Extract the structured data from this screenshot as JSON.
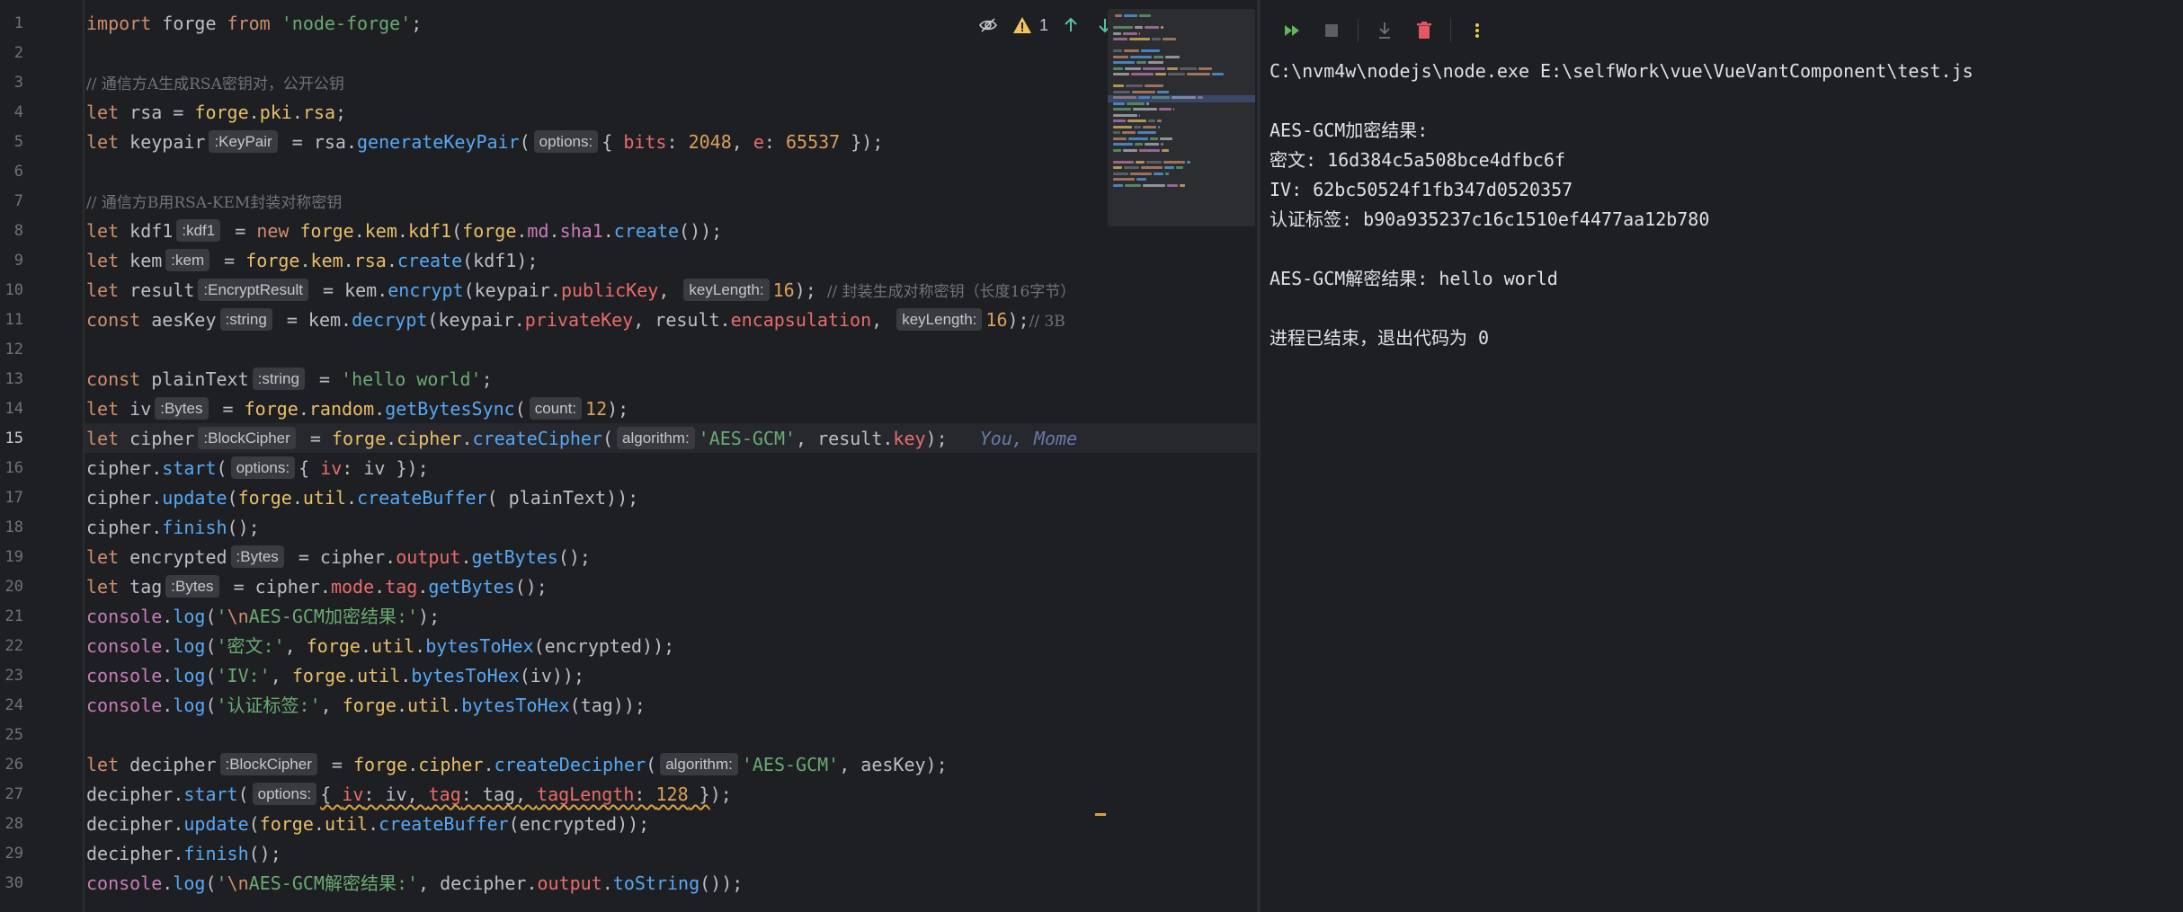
{
  "editor": {
    "active_line": 15,
    "line_numbers": [
      "1",
      "2",
      "3",
      "4",
      "5",
      "6",
      "7",
      "8",
      "9",
      "10",
      "11",
      "12",
      "13",
      "14",
      "15",
      "16",
      "17",
      "18",
      "19",
      "20",
      "21",
      "22",
      "23",
      "24",
      "25",
      "26",
      "27",
      "28",
      "29",
      "30"
    ],
    "warning_count": "1",
    "icons": [
      "reader-mode-icon",
      "warning-icon",
      "arrow-up-icon",
      "arrow-down-icon"
    ],
    "lines": [
      [
        [
          "kw",
          "import"
        ],
        [
          "id",
          " forge "
        ],
        [
          "kw",
          "from"
        ],
        [
          "id",
          " "
        ],
        [
          "str",
          "'node-forge'"
        ],
        [
          "id",
          ";"
        ]
      ],
      [],
      [
        [
          "cmt",
          "// 通信方A生成RSA密钥对，公开公钥"
        ]
      ],
      [
        [
          "kw",
          "let"
        ],
        [
          "id",
          " rsa = "
        ],
        [
          "obj",
          "forge"
        ],
        [
          "id",
          "."
        ],
        [
          "obj",
          "pki"
        ],
        [
          "id",
          "."
        ],
        [
          "obj",
          "rsa"
        ],
        [
          "id",
          ";"
        ]
      ],
      [
        [
          "kw",
          "let"
        ],
        [
          "id",
          " keypair"
        ],
        [
          "hint",
          ":KeyPair"
        ],
        [
          "id",
          " = rsa."
        ],
        [
          "fn",
          "generateKeyPair"
        ],
        [
          "id",
          "("
        ],
        [
          "hint",
          "options:"
        ],
        [
          "id",
          "{ "
        ],
        [
          "red",
          "bits"
        ],
        [
          "id",
          ": "
        ],
        [
          "numo",
          "2048"
        ],
        [
          "id",
          ", "
        ],
        [
          "red",
          "e"
        ],
        [
          "id",
          ": "
        ],
        [
          "numo",
          "65537"
        ],
        [
          "id",
          " });"
        ]
      ],
      [],
      [
        [
          "cmt",
          "// 通信方B用RSA-KEM封装对称密钥"
        ]
      ],
      [
        [
          "kw",
          "let"
        ],
        [
          "id",
          " kdf1"
        ],
        [
          "hint",
          ":kdf1"
        ],
        [
          "id",
          " = "
        ],
        [
          "kw",
          "new"
        ],
        [
          "id",
          " "
        ],
        [
          "obj",
          "forge"
        ],
        [
          "id",
          "."
        ],
        [
          "obj",
          "kem"
        ],
        [
          "id",
          "."
        ],
        [
          "obj",
          "kdf1"
        ],
        [
          "id",
          "("
        ],
        [
          "obj",
          "forge"
        ],
        [
          "id",
          "."
        ],
        [
          "prop",
          "md"
        ],
        [
          "id",
          "."
        ],
        [
          "prop",
          "sha1"
        ],
        [
          "id",
          "."
        ],
        [
          "fn",
          "create"
        ],
        [
          "id",
          "());"
        ]
      ],
      [
        [
          "kw",
          "let"
        ],
        [
          "id",
          " kem"
        ],
        [
          "hint",
          ":kem"
        ],
        [
          "id",
          " = "
        ],
        [
          "obj",
          "forge"
        ],
        [
          "id",
          "."
        ],
        [
          "obj",
          "kem"
        ],
        [
          "id",
          "."
        ],
        [
          "obj",
          "rsa"
        ],
        [
          "id",
          "."
        ],
        [
          "fn",
          "create"
        ],
        [
          "id",
          "(kdf1);"
        ]
      ],
      [
        [
          "kw",
          "let"
        ],
        [
          "id",
          " result"
        ],
        [
          "hint",
          ":EncryptResult"
        ],
        [
          "id",
          " = kem."
        ],
        [
          "fn",
          "encrypt"
        ],
        [
          "id",
          "(keypair."
        ],
        [
          "red",
          "publicKey"
        ],
        [
          "id",
          ", "
        ],
        [
          "hint",
          "keyLength:"
        ],
        [
          "numo",
          "16"
        ],
        [
          "id",
          "); "
        ],
        [
          "cmt",
          "// 封装生成对称密钥（长度16字节）"
        ]
      ],
      [
        [
          "kw",
          "const"
        ],
        [
          "id",
          " aesKey"
        ],
        [
          "hint",
          ":string"
        ],
        [
          "id",
          " = kem."
        ],
        [
          "fn",
          "decrypt"
        ],
        [
          "id",
          "(keypair."
        ],
        [
          "red",
          "privateKey"
        ],
        [
          "id",
          ", result."
        ],
        [
          "red",
          "encapsulation"
        ],
        [
          "id",
          ", "
        ],
        [
          "hint",
          "keyLength:"
        ],
        [
          "numo",
          "16"
        ],
        [
          "id",
          ");"
        ],
        [
          "cmt",
          "// 3B"
        ]
      ],
      [],
      [
        [
          "kw",
          "const"
        ],
        [
          "id",
          " plainText"
        ],
        [
          "hint",
          ":string"
        ],
        [
          "id",
          " = "
        ],
        [
          "str",
          "'hello world'"
        ],
        [
          "id",
          ";"
        ]
      ],
      [
        [
          "kw",
          "let"
        ],
        [
          "id",
          " iv"
        ],
        [
          "hint",
          ":Bytes"
        ],
        [
          "id",
          " = "
        ],
        [
          "obj",
          "forge"
        ],
        [
          "id",
          "."
        ],
        [
          "obj",
          "random"
        ],
        [
          "id",
          "."
        ],
        [
          "fn",
          "getBytesSync"
        ],
        [
          "id",
          "("
        ],
        [
          "hint",
          "count:"
        ],
        [
          "numo",
          "12"
        ],
        [
          "id",
          ");"
        ]
      ],
      [
        [
          "kw",
          "let"
        ],
        [
          "id",
          " cipher"
        ],
        [
          "hint",
          ":BlockCipher"
        ],
        [
          "id",
          " = "
        ],
        [
          "obj",
          "forge"
        ],
        [
          "id",
          "."
        ],
        [
          "obj",
          "cipher"
        ],
        [
          "id",
          "."
        ],
        [
          "fn",
          "createCipher"
        ],
        [
          "id",
          "("
        ],
        [
          "hint",
          "algorithm:"
        ],
        [
          "str",
          "'AES-GCM'"
        ],
        [
          "id",
          ", result."
        ],
        [
          "red",
          "key"
        ],
        [
          "id",
          ");   "
        ],
        [
          "blame",
          "You, Mome"
        ]
      ],
      [
        [
          "id",
          "cipher."
        ],
        [
          "fn",
          "start"
        ],
        [
          "id",
          "("
        ],
        [
          "hint",
          "options:"
        ],
        [
          "id",
          "{ "
        ],
        [
          "red",
          "iv"
        ],
        [
          "id",
          ": iv });"
        ]
      ],
      [
        [
          "id",
          "cipher."
        ],
        [
          "fn",
          "update"
        ],
        [
          "id",
          "("
        ],
        [
          "obj",
          "forge"
        ],
        [
          "id",
          "."
        ],
        [
          "obj",
          "util"
        ],
        [
          "id",
          "."
        ],
        [
          "fn",
          "createBuffer"
        ],
        [
          "id",
          "( plainText));"
        ]
      ],
      [
        [
          "id",
          "cipher."
        ],
        [
          "fn",
          "finish"
        ],
        [
          "id",
          "();"
        ]
      ],
      [
        [
          "kw",
          "let"
        ],
        [
          "id",
          " encrypted"
        ],
        [
          "hint",
          ":Bytes"
        ],
        [
          "id",
          " = cipher."
        ],
        [
          "red",
          "output"
        ],
        [
          "id",
          "."
        ],
        [
          "fn",
          "getBytes"
        ],
        [
          "id",
          "();"
        ]
      ],
      [
        [
          "kw",
          "let"
        ],
        [
          "id",
          " tag"
        ],
        [
          "hint",
          ":Bytes"
        ],
        [
          "id",
          " = cipher."
        ],
        [
          "red",
          "mode"
        ],
        [
          "id",
          "."
        ],
        [
          "red",
          "tag"
        ],
        [
          "id",
          "."
        ],
        [
          "fn",
          "getBytes"
        ],
        [
          "id",
          "();"
        ]
      ],
      [
        [
          "pink",
          "console"
        ],
        [
          "id",
          "."
        ],
        [
          "fn",
          "log"
        ],
        [
          "id",
          "("
        ],
        [
          "str",
          "'"
        ],
        [
          "esc",
          "\\n"
        ],
        [
          "str",
          "AES-GCM加密结果:'"
        ],
        [
          "id",
          ");"
        ]
      ],
      [
        [
          "pink",
          "console"
        ],
        [
          "id",
          "."
        ],
        [
          "fn",
          "log"
        ],
        [
          "id",
          "("
        ],
        [
          "str",
          "'密文:'"
        ],
        [
          "id",
          ", "
        ],
        [
          "obj",
          "forge"
        ],
        [
          "id",
          "."
        ],
        [
          "obj",
          "util"
        ],
        [
          "id",
          "."
        ],
        [
          "fn",
          "bytesToHex"
        ],
        [
          "id",
          "(encrypted));"
        ]
      ],
      [
        [
          "pink",
          "console"
        ],
        [
          "id",
          "."
        ],
        [
          "fn",
          "log"
        ],
        [
          "id",
          "("
        ],
        [
          "str",
          "'IV:'"
        ],
        [
          "id",
          ", "
        ],
        [
          "obj",
          "forge"
        ],
        [
          "id",
          "."
        ],
        [
          "obj",
          "util"
        ],
        [
          "id",
          "."
        ],
        [
          "fn",
          "bytesToHex"
        ],
        [
          "id",
          "(iv));"
        ]
      ],
      [
        [
          "pink",
          "console"
        ],
        [
          "id",
          "."
        ],
        [
          "fn",
          "log"
        ],
        [
          "id",
          "("
        ],
        [
          "str",
          "'认证标签:'"
        ],
        [
          "id",
          ", "
        ],
        [
          "obj",
          "forge"
        ],
        [
          "id",
          "."
        ],
        [
          "obj",
          "util"
        ],
        [
          "id",
          "."
        ],
        [
          "fn",
          "bytesToHex"
        ],
        [
          "id",
          "(tag));"
        ]
      ],
      [],
      [
        [
          "kw",
          "let"
        ],
        [
          "id",
          " decipher"
        ],
        [
          "hint",
          ":BlockCipher"
        ],
        [
          "id",
          " = "
        ],
        [
          "obj",
          "forge"
        ],
        [
          "id",
          "."
        ],
        [
          "obj",
          "cipher"
        ],
        [
          "id",
          "."
        ],
        [
          "fn",
          "createDecipher"
        ],
        [
          "id",
          "("
        ],
        [
          "hint",
          "algorithm:"
        ],
        [
          "str",
          "'AES-GCM'"
        ],
        [
          "id",
          ", aesKey);"
        ]
      ],
      [
        [
          "id",
          "decipher."
        ],
        [
          "fn",
          "start"
        ],
        [
          "id",
          "("
        ],
        [
          "hint",
          "options:"
        ],
        [
          "warn",
          "{ "
        ],
        [
          "warnred",
          "iv"
        ],
        [
          "warn",
          ": iv, "
        ],
        [
          "warnred",
          "tag"
        ],
        [
          "warn",
          ": tag, "
        ],
        [
          "warnred",
          "tagLength"
        ],
        [
          "warn",
          ": "
        ],
        [
          "warnnum",
          "128"
        ],
        [
          "warn",
          " }"
        ],
        [
          "id",
          ");"
        ]
      ],
      [
        [
          "id",
          "decipher."
        ],
        [
          "fn",
          "update"
        ],
        [
          "id",
          "("
        ],
        [
          "obj",
          "forge"
        ],
        [
          "id",
          "."
        ],
        [
          "obj",
          "util"
        ],
        [
          "id",
          "."
        ],
        [
          "fn",
          "createBuffer"
        ],
        [
          "id",
          "(encrypted));"
        ]
      ],
      [
        [
          "id",
          "decipher."
        ],
        [
          "fn",
          "finish"
        ],
        [
          "id",
          "();"
        ]
      ],
      [
        [
          "pink",
          "console"
        ],
        [
          "id",
          "."
        ],
        [
          "fn",
          "log"
        ],
        [
          "id",
          "("
        ],
        [
          "str",
          "'"
        ],
        [
          "esc",
          "\\n"
        ],
        [
          "str",
          "AES-GCM解密结果:'"
        ],
        [
          "id",
          ", decipher."
        ],
        [
          "red",
          "output"
        ],
        [
          "id",
          "."
        ],
        [
          "fn",
          "toString"
        ],
        [
          "id",
          "());"
        ]
      ]
    ]
  },
  "console": {
    "toolbar": [
      "rerun-icon",
      "stop-icon",
      "scroll-to-end-icon",
      "clear-icon",
      "more-icon"
    ],
    "lines": [
      "C:\\nvm4w\\nodejs\\node.exe E:\\selfWork\\vue\\VueVantComponent\\test.js",
      "",
      "AES-GCM加密结果:",
      "密文: 16d384c5a508bce4dfbc6f",
      "IV: 62bc50524f1fb347d0520357",
      "认证标签: b90a935237c16c1510ef4477aa12b780",
      "",
      "AES-GCM解密结果: hello world",
      "",
      "进程已结束，退出代码为 0"
    ]
  },
  "colors": {
    "background": "#1e1f22",
    "keyword": "#cf8e6d",
    "function": "#56a8f5",
    "string": "#6aab73",
    "warning": "#d9a343",
    "rerun": "#5fb85b",
    "clear": "#e55765"
  }
}
